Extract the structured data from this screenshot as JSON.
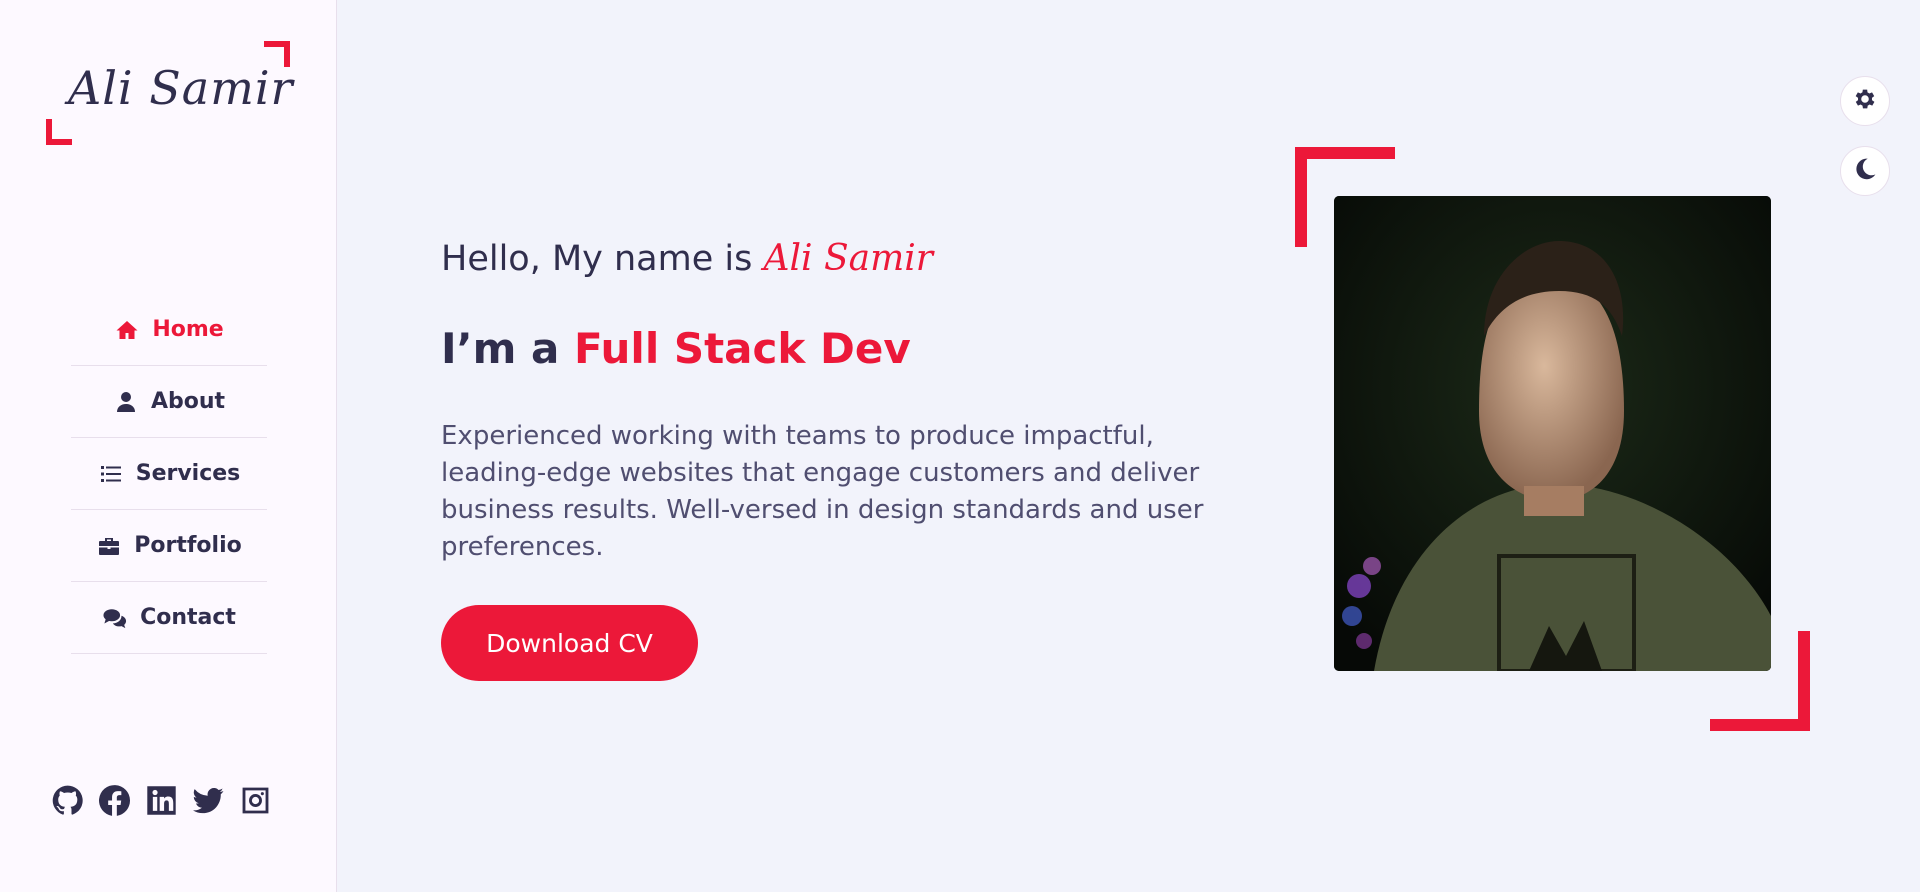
{
  "brand": {
    "logo_text": "Ali Samir"
  },
  "nav": {
    "items": [
      {
        "label": "Home",
        "icon": "home-icon",
        "active": true
      },
      {
        "label": "About",
        "icon": "user-icon",
        "active": false
      },
      {
        "label": "Services",
        "icon": "list-icon",
        "active": false
      },
      {
        "label": "Portfolio",
        "icon": "briefcase-icon",
        "active": false
      },
      {
        "label": "Contact",
        "icon": "comments-icon",
        "active": false
      }
    ]
  },
  "social": [
    "github-icon",
    "facebook-icon",
    "linkedin-icon",
    "twitter-icon",
    "instagram-icon"
  ],
  "hero": {
    "hello_prefix": "Hello, My name is ",
    "name": "Ali Samir",
    "role_prefix": "I’m a ",
    "role_accent": "Full Stack Dev",
    "description": "Experienced working with teams to produce impactful, leading-edge websites that engage customers and deliver business results. Well-versed in design standards and user preferences.",
    "cta_label": "Download CV"
  },
  "controls": [
    "gear-icon",
    "moon-icon"
  ],
  "colors": {
    "accent": "#ec1839",
    "text": "#302e4d",
    "background": "#f2f3fb",
    "sidebar": "#fdf9ff"
  }
}
